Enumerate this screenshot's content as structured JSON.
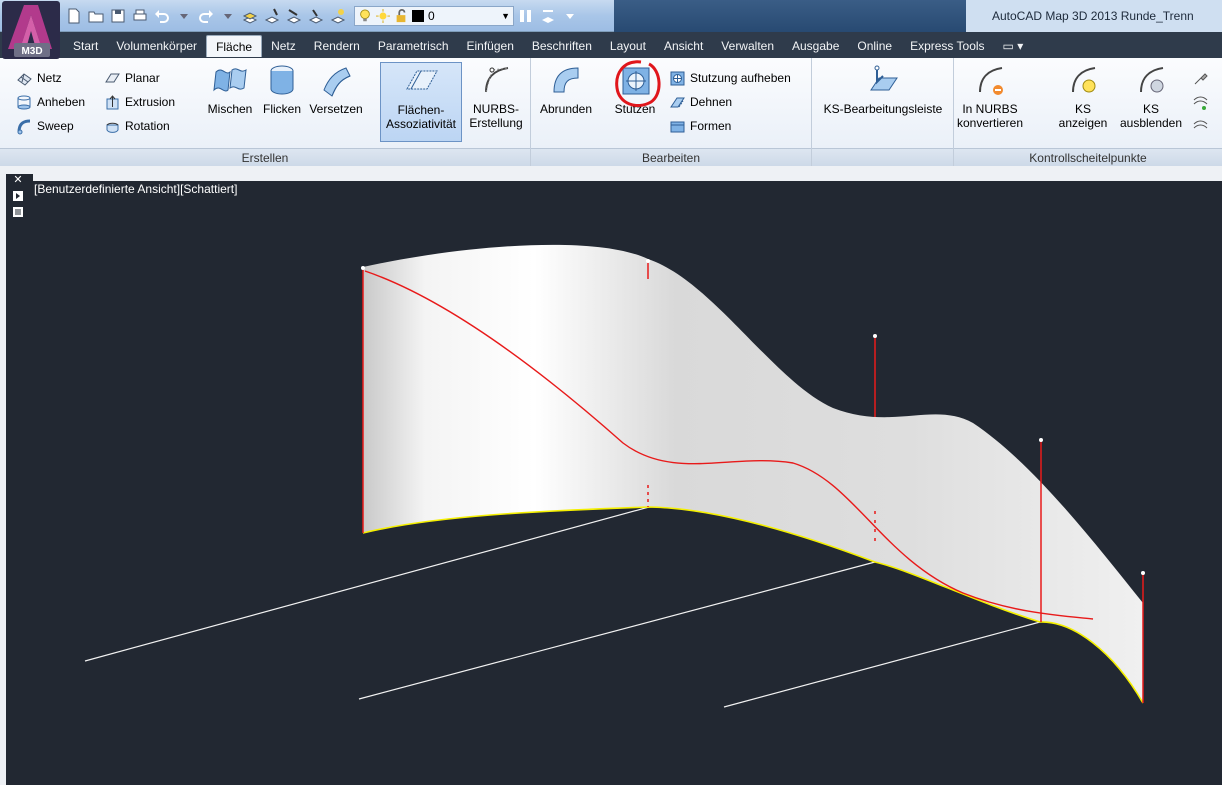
{
  "titlebar": {
    "app_badge": "M3D",
    "layer_value": "0",
    "title": "AutoCAD Map 3D 2013   Runde_Trenn"
  },
  "tabs": [
    {
      "label": "Start",
      "active": false
    },
    {
      "label": "Volumenkörper",
      "active": false
    },
    {
      "label": "Fläche",
      "active": true
    },
    {
      "label": "Netz",
      "active": false
    },
    {
      "label": "Rendern",
      "active": false
    },
    {
      "label": "Parametrisch",
      "active": false
    },
    {
      "label": "Einfügen",
      "active": false
    },
    {
      "label": "Beschriften",
      "active": false
    },
    {
      "label": "Layout",
      "active": false
    },
    {
      "label": "Ansicht",
      "active": false
    },
    {
      "label": "Verwalten",
      "active": false
    },
    {
      "label": "Ausgabe",
      "active": false
    },
    {
      "label": "Online",
      "active": false
    },
    {
      "label": "Express Tools",
      "active": false
    }
  ],
  "ribbon": {
    "erstellen": {
      "title": "Erstellen",
      "netz": "Netz",
      "anheben": "Anheben",
      "sweep": "Sweep",
      "planar": "Planar",
      "extrusion": "Extrusion",
      "rotation": "Rotation",
      "mischen": "Mischen",
      "flicken": "Flicken",
      "versetzen": "Versetzen",
      "assoc_line1": "Flächen-",
      "assoc_line2": "Assoziativität",
      "nurbs_line1": "NURBS-",
      "nurbs_line2": "Erstellung"
    },
    "bearbeiten": {
      "title": "Bearbeiten",
      "abrunden": "Abrunden",
      "stutzen": "Stutzen",
      "stutzung_aufheben": "Stutzung aufheben",
      "dehnen": "Dehnen",
      "formen": "Formen"
    },
    "ks_leiste": "KS-Bearbeitungsleiste",
    "kontroll": {
      "title": "Kontrollscheitelpunkte",
      "convert_line1": "In NURBS",
      "convert_line2": "konvertieren",
      "show_line1": "KS",
      "show_line2": "anzeigen",
      "hide_line1": "KS",
      "hide_line2": "ausblenden"
    }
  },
  "viewport": {
    "label": "[Benutzerdefinierte Ansicht][Schattiert]",
    "close": "✕"
  },
  "colors": {
    "canvas": "#222832",
    "surface": "#e6e6e6",
    "curve": "#e81a1a",
    "edge": "#f5f000",
    "highlight_circle": "#e0161c"
  }
}
